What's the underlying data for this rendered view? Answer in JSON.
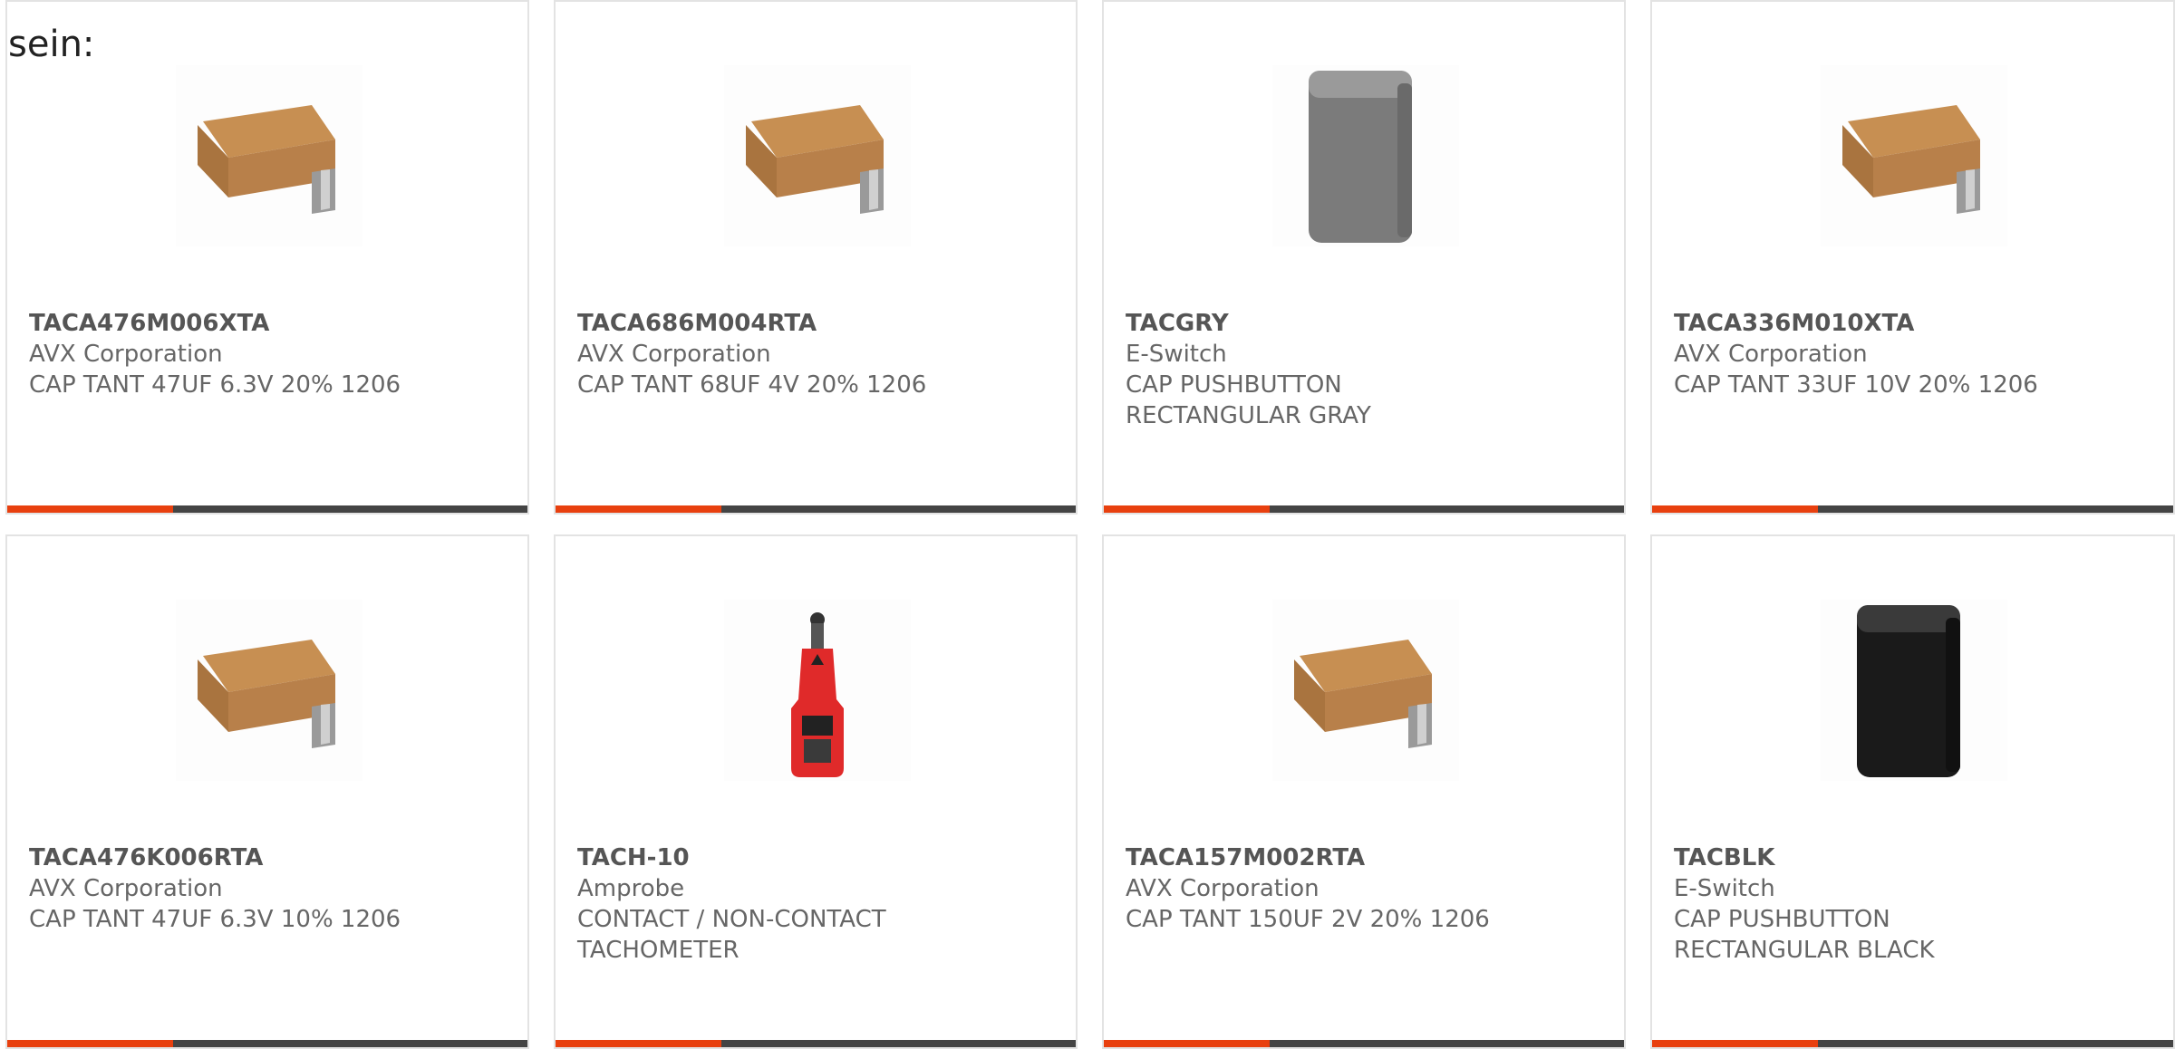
{
  "intro_text": "sein:",
  "colors": {
    "accent": "#e8400f",
    "bar": "#444444",
    "border": "#e3e3e3"
  },
  "products": [
    {
      "part_number": "TACA476M006XTA",
      "manufacturer": "AVX Corporation",
      "description": "CAP TANT 47UF 6.3V 20% 1206",
      "image": "tantalum-capacitor"
    },
    {
      "part_number": "TACA686M004RTA",
      "manufacturer": "AVX Corporation",
      "description": "CAP TANT 68UF 4V 20% 1206",
      "image": "tantalum-capacitor"
    },
    {
      "part_number": "TACGRY",
      "manufacturer": "E-Switch",
      "description": "CAP PUSHBUTTON RECTANGULAR GRAY",
      "image": "gray-pushbutton-cap"
    },
    {
      "part_number": "TACA336M010XTA",
      "manufacturer": "AVX Corporation",
      "description": "CAP TANT 33UF 10V 20% 1206",
      "image": "tantalum-capacitor"
    },
    {
      "part_number": "TACA476K006RTA",
      "manufacturer": "AVX Corporation",
      "description": "CAP TANT 47UF 6.3V 10% 1206",
      "image": "tantalum-capacitor"
    },
    {
      "part_number": "TACH-10",
      "manufacturer": "Amprobe",
      "description": "CONTACT / NON-CONTACT TACHOMETER",
      "image": "tachometer"
    },
    {
      "part_number": "TACA157M002RTA",
      "manufacturer": "AVX Corporation",
      "description": "CAP TANT 150UF 2V 20% 1206",
      "image": "tantalum-capacitor"
    },
    {
      "part_number": "TACBLK",
      "manufacturer": "E-Switch",
      "description": "CAP PUSHBUTTON RECTANGULAR BLACK",
      "image": "black-pushbutton-cap"
    }
  ]
}
